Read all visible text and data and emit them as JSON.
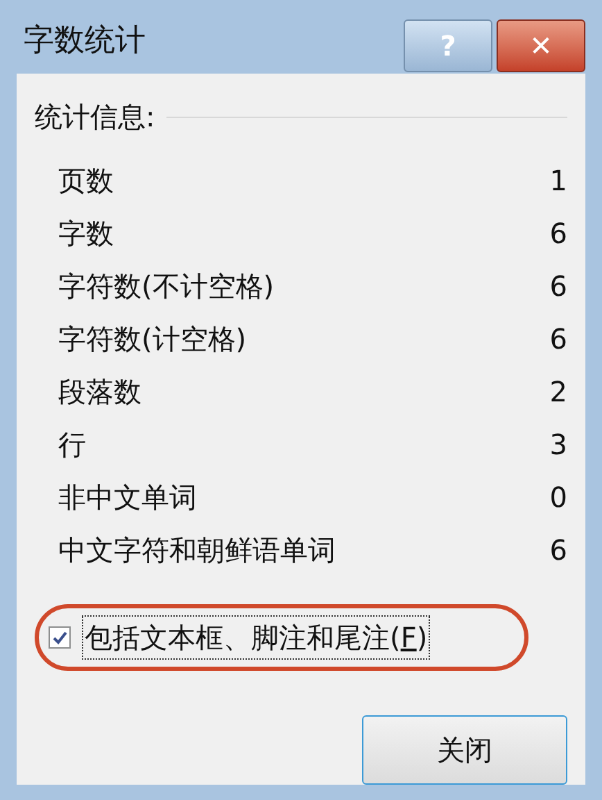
{
  "window": {
    "title": "字数统计",
    "buttons": [
      {
        "kind": "help",
        "label": "?"
      },
      {
        "kind": "close",
        "label": "✕"
      }
    ]
  },
  "section_title": "统计信息:",
  "stats": [
    {
      "label": "页数",
      "value": "1"
    },
    {
      "label": "字数",
      "value": "6"
    },
    {
      "label": "字符数(不计空格)",
      "value": "6"
    },
    {
      "label": "字符数(计空格)",
      "value": "6"
    },
    {
      "label": "段落数",
      "value": "2"
    },
    {
      "label": "行",
      "value": "3"
    },
    {
      "label": "非中文单词",
      "value": "0"
    },
    {
      "label": "中文字符和朝鲜语单词",
      "value": "6"
    }
  ],
  "option": {
    "label_before": "包括文本框、脚注和尾注(",
    "access_key": "F",
    "label_after": ")",
    "checked": true,
    "highlighted": true
  },
  "close_button": "关闭"
}
